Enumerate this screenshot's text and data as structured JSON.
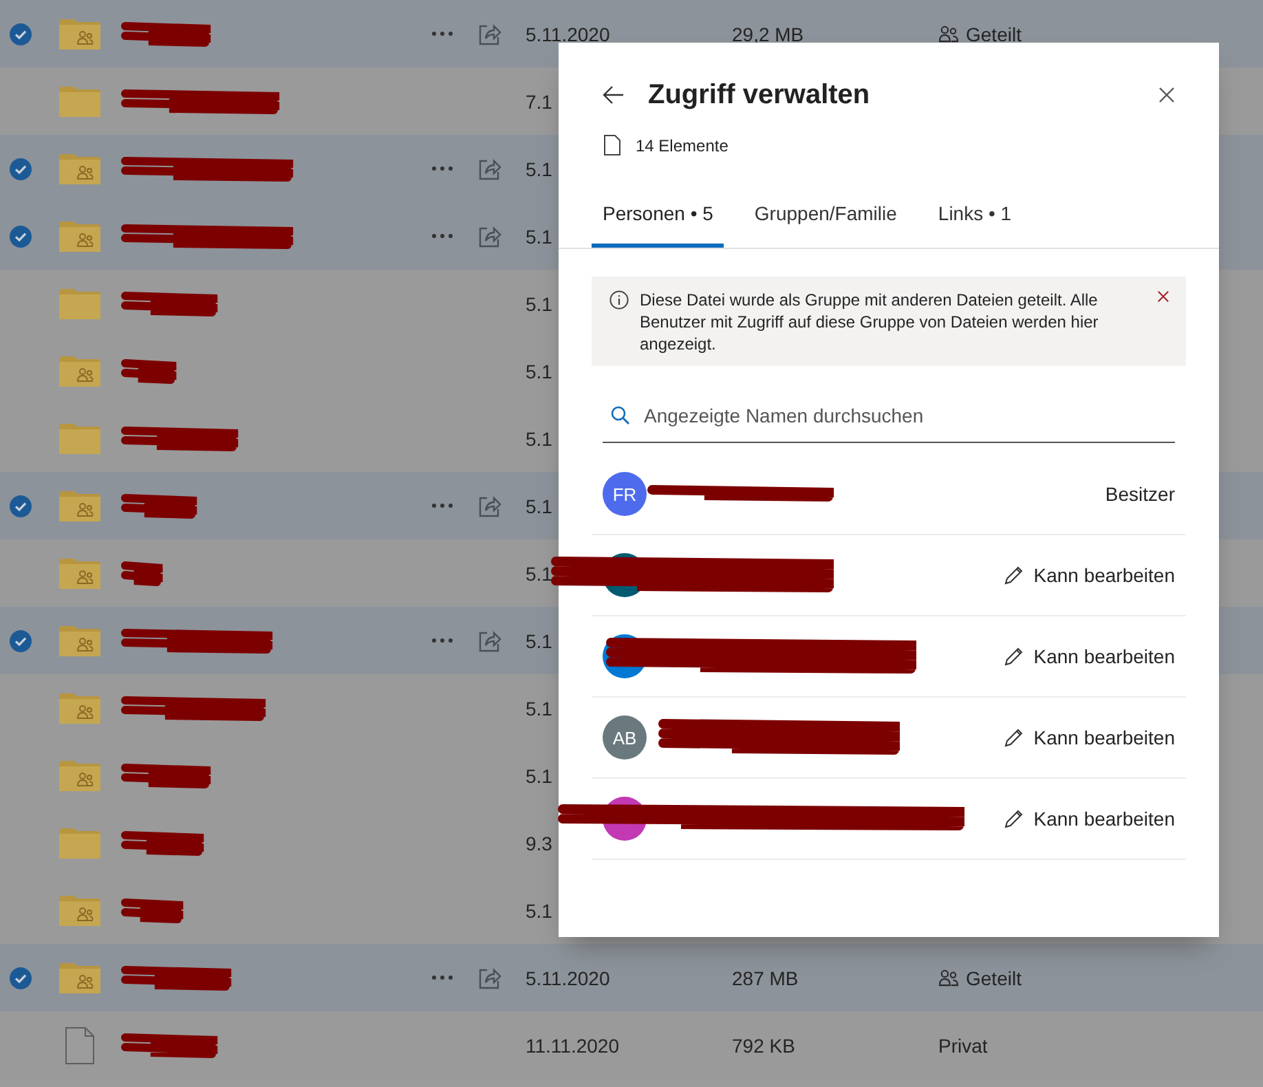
{
  "file_list": {
    "rows": [
      {
        "selected": true,
        "kind": "shared-folder",
        "date": "5.11.2020",
        "size": "29,2 MB",
        "sharing": {
          "label": "Geteilt",
          "kind": "shared"
        }
      },
      {
        "selected": false,
        "kind": "folder",
        "date": "7.1"
      },
      {
        "selected": true,
        "kind": "shared-folder",
        "date": "5.1"
      },
      {
        "selected": true,
        "kind": "shared-folder",
        "date": "5.1"
      },
      {
        "selected": false,
        "kind": "folder",
        "date": "5.1"
      },
      {
        "selected": false,
        "kind": "shared-folder",
        "date": "5.1"
      },
      {
        "selected": false,
        "kind": "folder",
        "date": "5.1"
      },
      {
        "selected": true,
        "kind": "shared-folder",
        "date": "5.1"
      },
      {
        "selected": false,
        "kind": "shared-folder",
        "date": "5.1"
      },
      {
        "selected": true,
        "kind": "shared-folder",
        "date": "5.1"
      },
      {
        "selected": false,
        "kind": "shared-folder",
        "date": "5.1"
      },
      {
        "selected": false,
        "kind": "shared-folder",
        "date": "5.1"
      },
      {
        "selected": false,
        "kind": "folder",
        "date": "9.3"
      },
      {
        "selected": false,
        "kind": "shared-folder",
        "date": "5.1"
      },
      {
        "selected": true,
        "kind": "shared-folder",
        "date": "5.11.2020",
        "size": "287 MB",
        "sharing": {
          "label": "Geteilt",
          "kind": "shared"
        }
      },
      {
        "selected": false,
        "kind": "file",
        "date": "11.11.2020",
        "size": "792 KB",
        "sharing": {
          "label": "Privat",
          "kind": "private"
        }
      }
    ]
  },
  "dialog": {
    "title": "Zugriff verwalten",
    "items": "14 Elemente",
    "tabs": [
      {
        "label": "Personen • 5",
        "selected": true
      },
      {
        "label": "Gruppen/Familie",
        "selected": false
      },
      {
        "label": "Links • 1",
        "selected": false
      }
    ],
    "notice": "Diese Datei wurde als Gruppe mit anderen Dateien geteilt. Alle Benutzer mit Zugriff auf diese Gruppe von Dateien werden hier angezeigt.",
    "search": {
      "placeholder": "Angezeigte Namen durchsuchen"
    },
    "people": [
      {
        "initials": "FR",
        "color": "#4f6bed",
        "role": "Besitzer",
        "kind": "owner"
      },
      {
        "color": "#005b70",
        "role": "Kann bearbeiten",
        "kind": "editor"
      },
      {
        "color": "#0078d4",
        "role": "Kann bearbeiten",
        "kind": "editor"
      },
      {
        "initials": "AB",
        "color": "#69797e",
        "role": "Kann bearbeiten",
        "kind": "editor"
      },
      {
        "color": "#c239b3",
        "role": "Kann bearbeiten",
        "kind": "editor"
      }
    ]
  }
}
